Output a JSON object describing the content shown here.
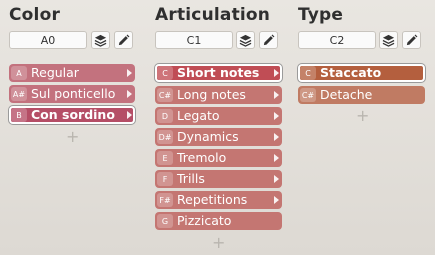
{
  "columns": [
    {
      "title": "Color",
      "key": "A0",
      "items": [
        {
          "key": "A",
          "label": "Regular"
        },
        {
          "key": "A#",
          "label": "Sul ponticello"
        },
        {
          "key": "B",
          "label": "Con sordino"
        }
      ],
      "selected_index": 2,
      "add_label": "+"
    },
    {
      "title": "Articulation",
      "key": "C1",
      "items": [
        {
          "key": "C",
          "label": "Short notes"
        },
        {
          "key": "C#",
          "label": "Long notes"
        },
        {
          "key": "D",
          "label": "Legato"
        },
        {
          "key": "D#",
          "label": "Dynamics"
        },
        {
          "key": "E",
          "label": "Tremolo"
        },
        {
          "key": "F",
          "label": "Trills"
        },
        {
          "key": "F#",
          "label": "Repetitions"
        },
        {
          "key": "G",
          "label": "Pizzicato"
        }
      ],
      "selected_index": 0,
      "add_label": "+"
    },
    {
      "title": "Type",
      "key": "C2",
      "items": [
        {
          "key": "C",
          "label": "Staccato"
        },
        {
          "key": "C#",
          "label": "Detache"
        }
      ],
      "selected_index": 0,
      "add_label": "+"
    }
  ],
  "icons": {
    "layers": "layers-icon",
    "edit": "pencil-icon"
  },
  "colors": {
    "background": "#e9e6e1",
    "color_item": "#c3727e",
    "articulation_item": "#c47672",
    "type_item": "#c07b63",
    "selected_border": "#ffffff"
  }
}
